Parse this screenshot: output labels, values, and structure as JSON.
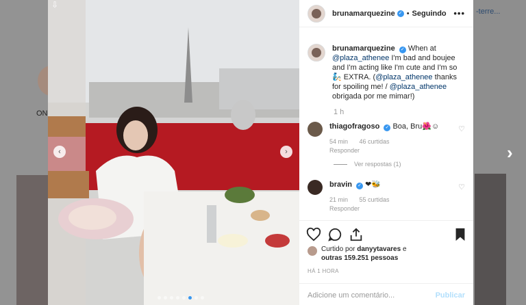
{
  "background": {
    "left_label": "ON",
    "right_label": "-terre..."
  },
  "post": {
    "author": "brunamarquezine",
    "follow_status": "Seguindo",
    "caption": {
      "p1": "When at",
      "mention1": "@plaza_athenee",
      "p2": " I'm bad and boujee and I'm acting like I'm cute and I'm so 🧞 EXTRA. (",
      "mention2": "@plaza_athenee",
      "p3": " thanks for spoiling me! / ",
      "mention3": "@plaza_athenee",
      "p4": " obrigada por me mimar!)"
    },
    "time": "1 h"
  },
  "comments": [
    {
      "user": "thiagofragoso",
      "text": "Boa, Bru🌺☺",
      "age": "54 min",
      "likes": "46 curtidas",
      "reply": "Responder",
      "view_replies": "Ver respostas (1)"
    },
    {
      "user": "bravin",
      "text": "❤🐝",
      "age": "21 min",
      "likes": "55 curtidas",
      "reply": "Responder"
    }
  ],
  "likes": {
    "prefix": "Curtido por",
    "user": "danyytavares",
    "joiner": " e",
    "others": "outras 159.251 pessoas"
  },
  "timestamp": "HÁ 1 HORA",
  "add_comment": {
    "placeholder": "Adicione um comentário...",
    "publish": "Publicar"
  },
  "carousel": {
    "slides": 8,
    "active": 6
  },
  "icons": [
    "download-icon",
    "verified-icon",
    "more-icon",
    "heart-icon",
    "comment-icon",
    "share-icon",
    "bookmark-icon",
    "chevron-left-icon",
    "chevron-right-icon"
  ],
  "colors": {
    "link": "#003569",
    "verified": "#3897f0",
    "muted": "#999999",
    "publish_disabled": "#b2dffc"
  }
}
